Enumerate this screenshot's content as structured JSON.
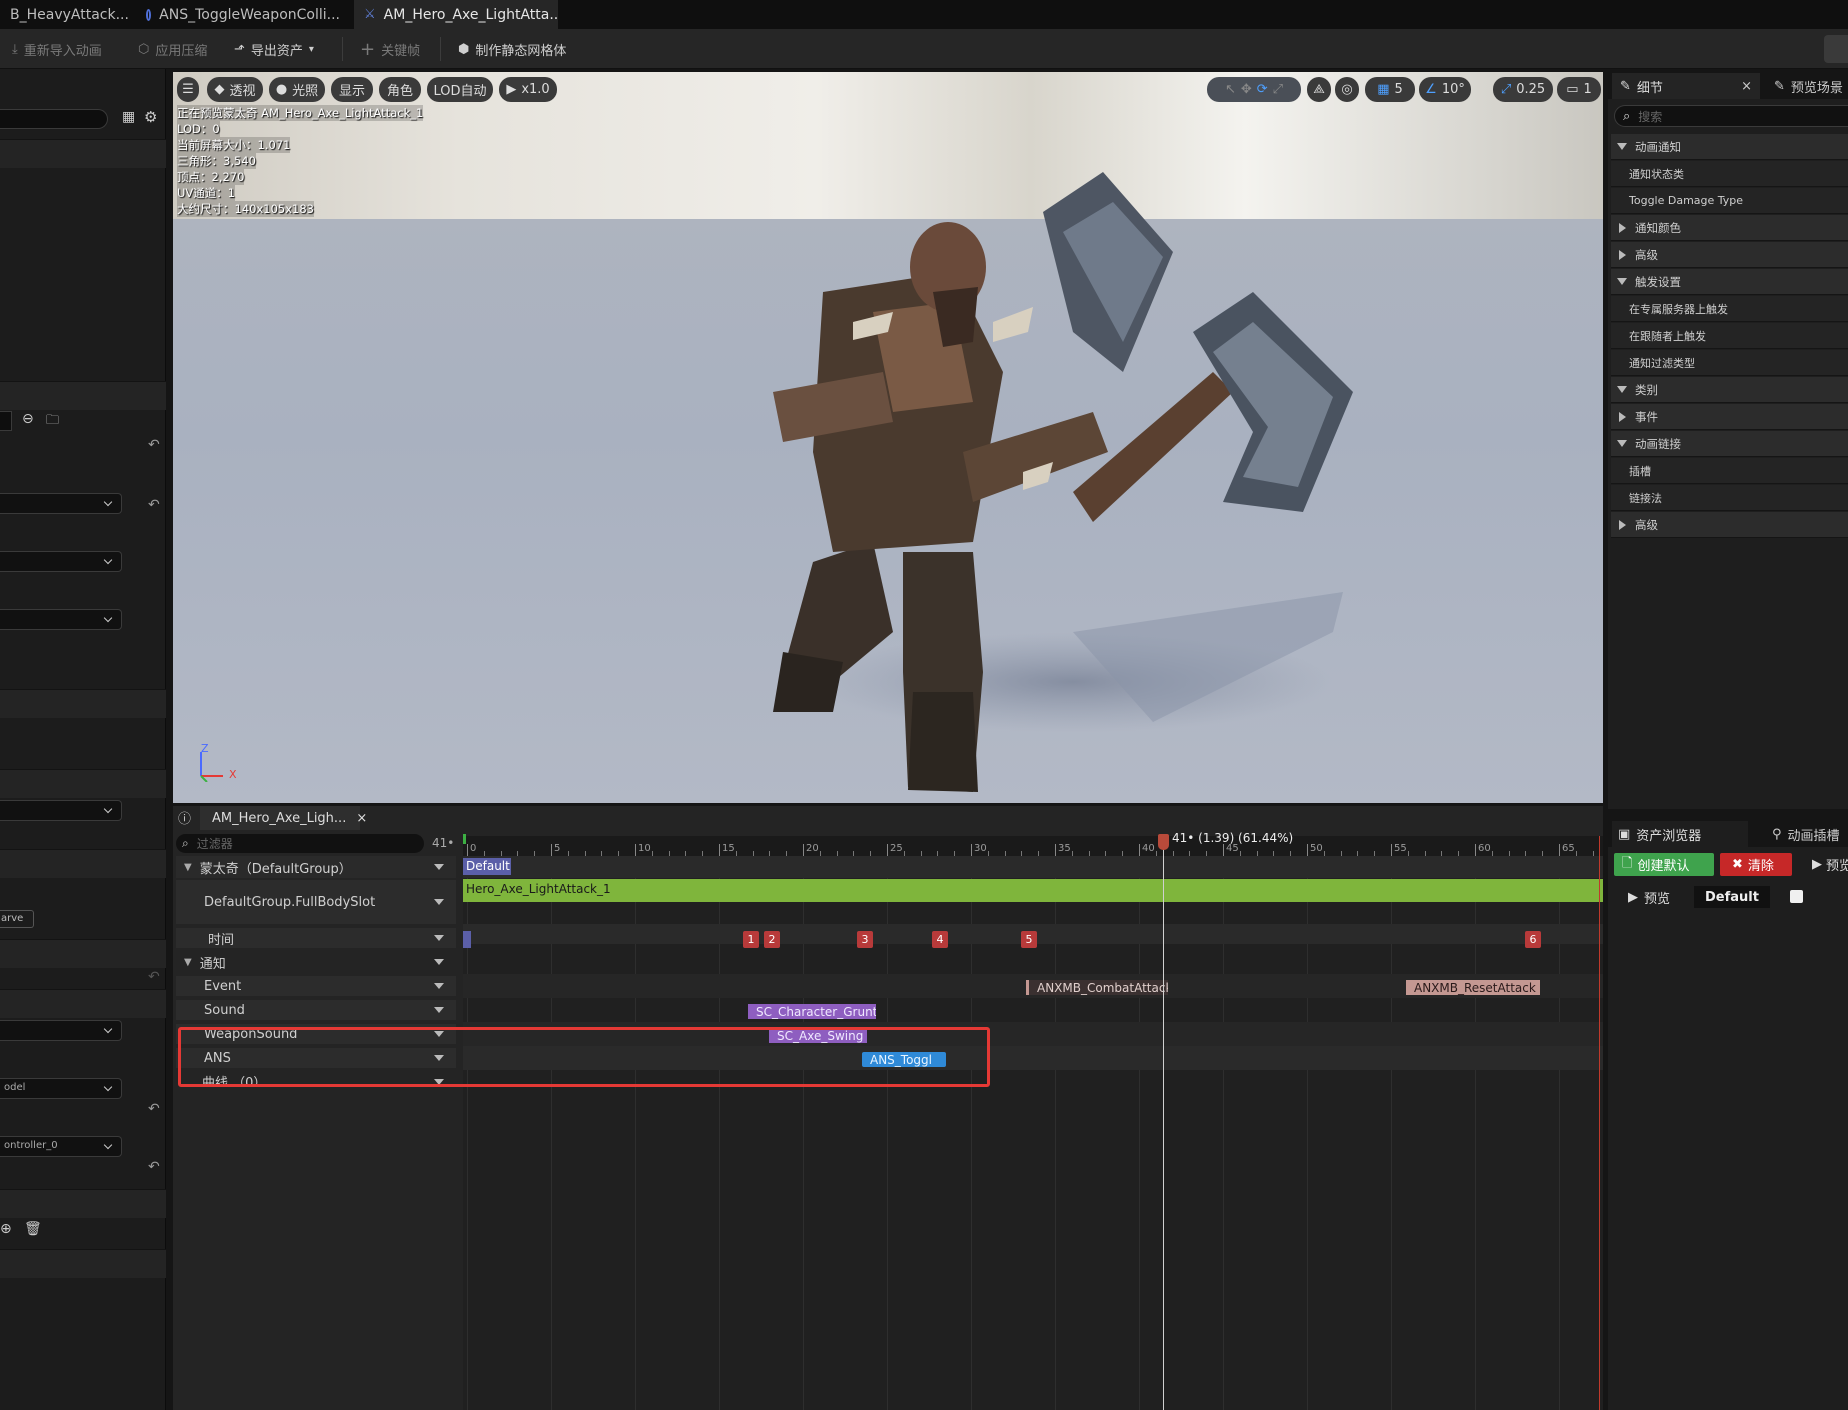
{
  "tabs": [
    {
      "label": "B_HeavyAttack... •"
    },
    {
      "label": "ANS_ToggleWeaponColli..."
    },
    {
      "label": "AM_Hero_Axe_LightAtta...",
      "close": "×"
    }
  ],
  "toolbar": {
    "reimport": "重新导入动画",
    "apply_compression": "应用压缩",
    "export_asset": "导出资产",
    "keyframe": "关键帧",
    "make_static_mesh": "制作静态网格体"
  },
  "viewport": {
    "buttons": {
      "perspective": "透视",
      "lighting": "光照",
      "show": "显示",
      "character": "角色",
      "lod": "LOD自动",
      "speed": "x1.0"
    },
    "info": [
      "正在预览蒙太奇 AM_Hero_Axe_LightAttack_1",
      "LOD：0",
      "当前屏幕大小：1.071",
      "三角形：3,540",
      "顶点：2,270",
      "UV通道：1",
      "大约尺寸：140x105x183"
    ],
    "right_controls": {
      "grid_value": "5",
      "angle_value": "10°",
      "scale_value": "0.25",
      "camera_value": "1"
    },
    "axis": {
      "z": "Z",
      "x": "X"
    }
  },
  "details": {
    "tab_details": "细节",
    "tab_preview_scene": "预览场景",
    "search_placeholder": "搜索",
    "rows": [
      {
        "label": "动画通知",
        "type": "category",
        "expanded": true
      },
      {
        "label": "通知状态类",
        "type": "item"
      },
      {
        "label": "Toggle Damage Type",
        "type": "item"
      },
      {
        "label": "通知颜色",
        "type": "category",
        "expanded": false
      },
      {
        "label": "高级",
        "type": "category",
        "expanded": false
      },
      {
        "label": "触发设置",
        "type": "category",
        "expanded": true
      },
      {
        "label": "在专属服务器上触发",
        "type": "item"
      },
      {
        "label": "在跟随者上触发",
        "type": "item"
      },
      {
        "label": "通知过滤类型",
        "type": "item"
      },
      {
        "label": "类别",
        "type": "category",
        "expanded": true
      },
      {
        "label": "事件",
        "type": "category",
        "expanded": false
      },
      {
        "label": "动画链接",
        "type": "category",
        "expanded": true
      },
      {
        "label": "插槽",
        "type": "item"
      },
      {
        "label": "链接法",
        "type": "item"
      },
      {
        "label": "高级",
        "type": "category",
        "expanded": false
      }
    ]
  },
  "sequencer": {
    "tab_label": "AM_Hero_Axe_Ligh...",
    "filter_placeholder": "过滤器",
    "frame_count": "41•",
    "playhead_label": "41• (1.39) (61.44%)",
    "ticks": [
      "0",
      "5",
      "10",
      "15",
      "20",
      "25",
      "30",
      "35",
      "40",
      "45",
      "50",
      "55",
      "60",
      "65"
    ],
    "tracks": {
      "montage": "蒙太奇（DefaultGroup）",
      "slot": "DefaultGroup.FullBodySlot",
      "time": "时间",
      "notifies": "通知",
      "event": "Event",
      "sound": "Sound",
      "weapon_sound": "WeaponSound",
      "ans": "ANS",
      "curves": "曲线 （0）"
    },
    "section_default": "Default",
    "anim_segment": "Hero_Axe_LightAttack_1",
    "markers": [
      "1",
      "2",
      "3",
      "4",
      "5",
      "6"
    ],
    "notifies": {
      "combat_attack": "ANXMB_CombatAttack",
      "reset_attack": "ANXMB_ResetAttack",
      "character_grunt": "SC_Character_Grunt",
      "axe_swing": "SC_Axe_Swing",
      "ans_toggle": "ANS_Toggl"
    }
  },
  "asset_browser": {
    "tab_label": "资产浏览器",
    "tab_anim_slots": "动画插槽",
    "create_default": "创建默认",
    "clear": "清除",
    "preview": "预览",
    "preview_short": "预览",
    "default_value": "Default"
  },
  "left_panel": {
    "curve_label": "arve",
    "model_combo": "odel",
    "controller_combo": "ontroller_0"
  },
  "colors": {
    "accent_green": "#7fb53c",
    "notify_purple": "#8e5ec0",
    "notify_blue": "#2f8ad8",
    "notify_pink": "#c49892",
    "marker_red": "#b83a3a",
    "highlight_red": "#e53935"
  }
}
